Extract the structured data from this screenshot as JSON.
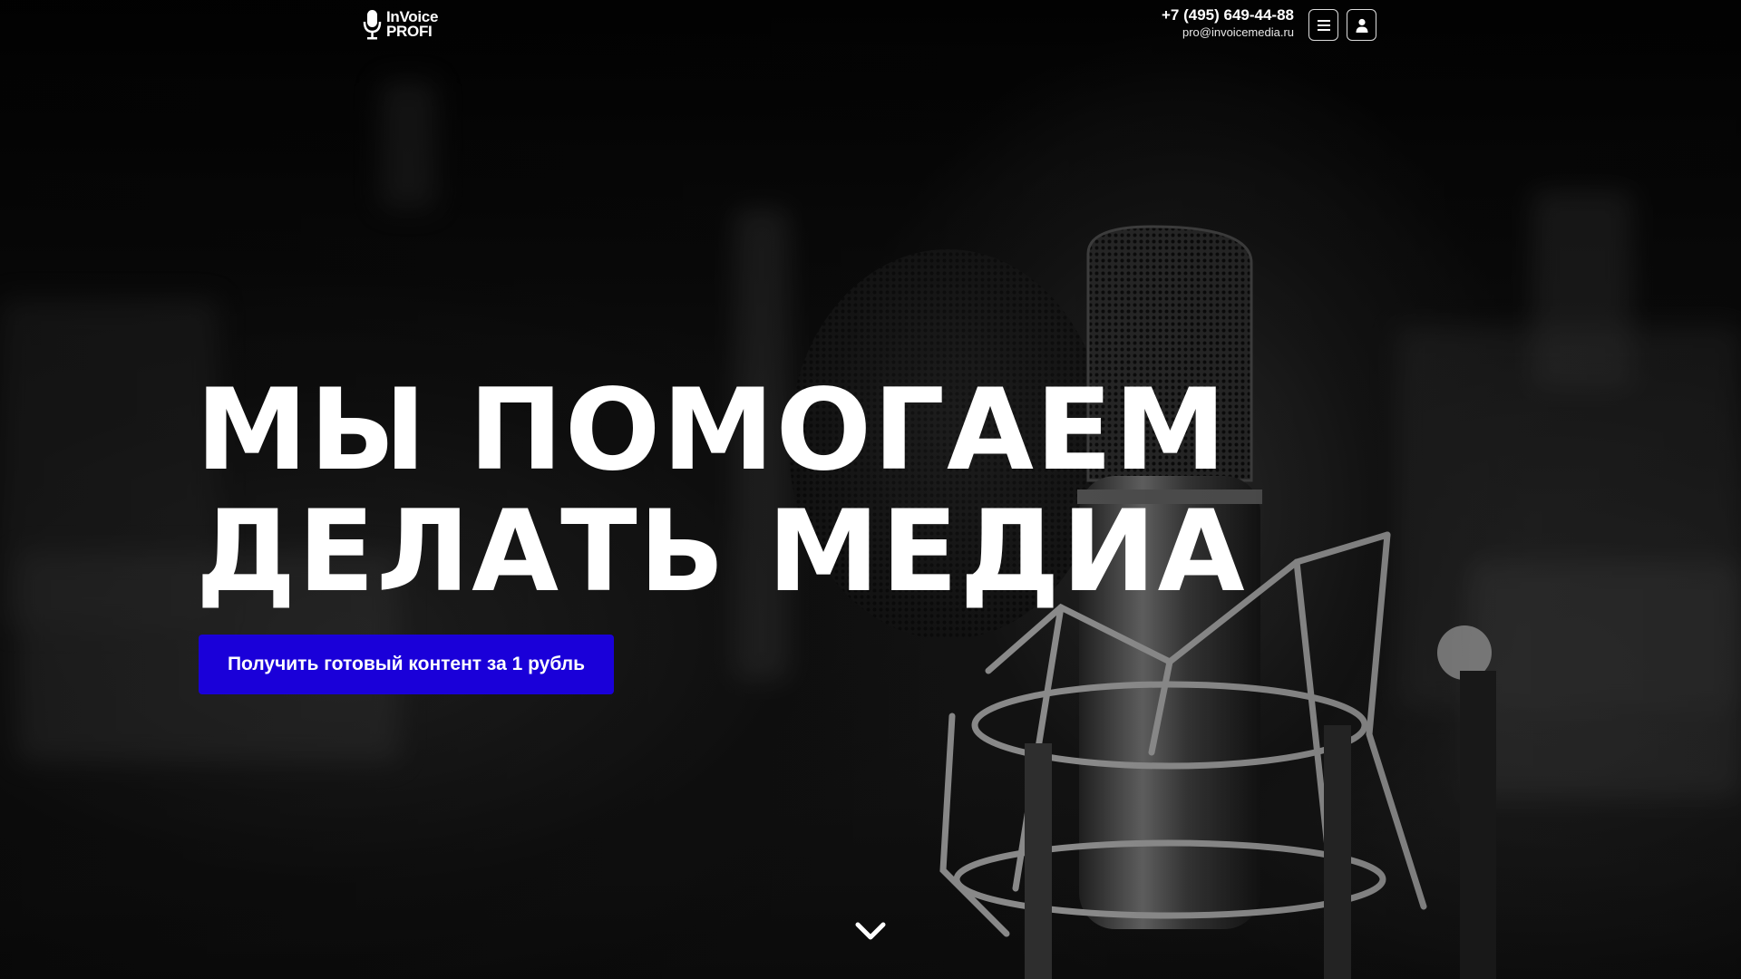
{
  "header": {
    "logo": {
      "line1": "InVoice",
      "line2": "PROFI",
      "icon": "microphone-icon"
    },
    "phone": "+7 (495) 649-44-88",
    "email": "pro@invoicemedia.ru",
    "menu_icon": "hamburger-icon",
    "account_icon": "user-icon"
  },
  "hero": {
    "headline_line1": "МЫ ПОМОГАЕМ",
    "headline_line2": "ДЕЛАТЬ МЕДИА",
    "cta_label": "Получить готовый контент за 1 рубль",
    "scroll_icon": "chevron-down-icon"
  },
  "colors": {
    "accent": "#1a00d9",
    "text": "#ffffff",
    "background": "#050505"
  }
}
